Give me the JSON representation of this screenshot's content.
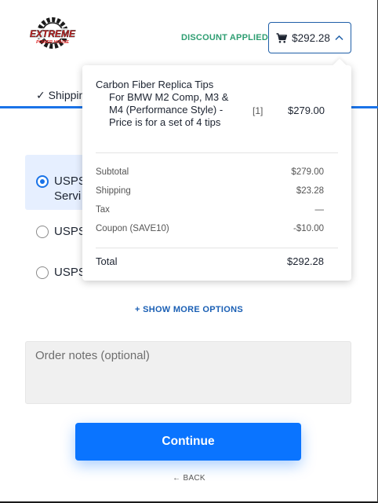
{
  "header": {
    "logo": {
      "line1": "EXTREME",
      "line2": "POWER HOUSE"
    },
    "discount_status": "DISCOUNT APPLIED",
    "cart_total": "$292.28"
  },
  "steps": {
    "current_label": "✓ Shipping"
  },
  "shipping_options": [
    {
      "label": "USPS",
      "subtext": "Servi",
      "selected": true
    },
    {
      "label": "USPS",
      "selected": false
    },
    {
      "label": "USPS",
      "selected": false
    }
  ],
  "show_more_label": "+ SHOW MORE OPTIONS",
  "order_notes": {
    "placeholder": "Order notes (optional)"
  },
  "continue_label": "Continue",
  "back_label": "← BACK",
  "cart_summary": {
    "item": {
      "name_first": "Carbon Fiber Replica Tips",
      "name_rest": "For BMW M2 Comp, M3 & M4 (Performance Style) - Price is for a set of 4 tips",
      "quantity": "[1]",
      "price": "$279.00"
    },
    "rows": [
      {
        "label": "Subtotal",
        "value": "$279.00"
      },
      {
        "label": "Shipping",
        "value": "$23.28"
      },
      {
        "label": "Tax",
        "value": "—"
      },
      {
        "label": "Coupon (SAVE10)",
        "value": "-$10.00"
      }
    ],
    "total_label": "Total",
    "total_value": "$292.28"
  },
  "colors": {
    "accent": "#0a74ff",
    "discount": "#2e9e72",
    "brand_red": "#d81e1e",
    "selected_bg": "#e6efff"
  },
  "icons": {
    "cart": "shopping-cart-icon",
    "chevron": "chevron-up-icon"
  }
}
